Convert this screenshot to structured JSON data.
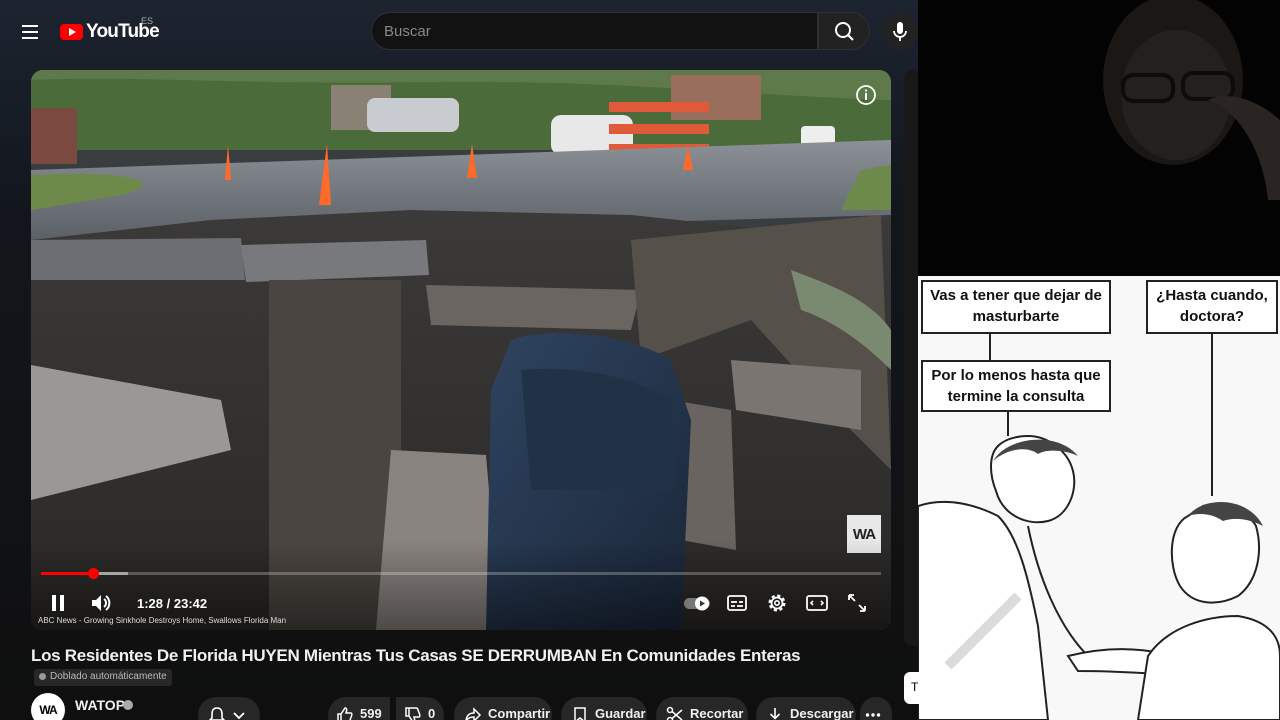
{
  "header": {
    "logo_text": "YouTube",
    "region": "ES",
    "search_placeholder": "Buscar"
  },
  "player": {
    "time": "1:28 / 23:42",
    "progress_fraction": 0.062,
    "loaded_fraction": 0.104,
    "source_caption": "ABC News - Growing Sinkhole Destroys Home, Swallows Florida Man",
    "watermark": "WA"
  },
  "video": {
    "title": "Los Residentes De Florida HUYEN Mientras Tus Casas SE DERRUMBAN En Comunidades Enteras",
    "dub_badge": "Doblado automáticamente"
  },
  "channel": {
    "avatar_text": "WA",
    "name": "WATOP"
  },
  "actions": {
    "likes": "599",
    "dislikes": "0",
    "share": "Compartir",
    "save": "Guardar",
    "clip": "Recortar",
    "download": "Descargar"
  },
  "meme": {
    "bubble_1": "Vas a tener que dejar de masturbarte",
    "bubble_2": "¿Hasta cuando, doctora?",
    "bubble_3": "Por lo menos hasta que termine la consulta"
  },
  "side_chip": "T",
  "colors": {
    "accent": "#ff0000",
    "background": "#0f0f0f",
    "pill": "#272727"
  }
}
